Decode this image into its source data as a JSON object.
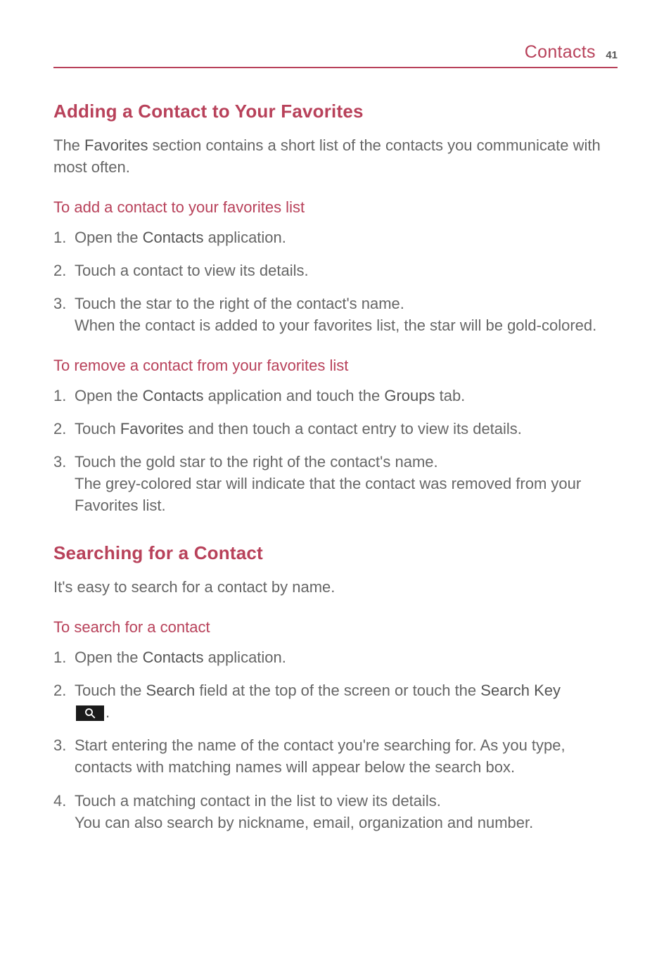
{
  "header": {
    "title": "Contacts",
    "page_number": "41"
  },
  "section1": {
    "heading": "Adding a Contact to Your Favorites",
    "intro_pre": "The ",
    "intro_bold": "Favorites",
    "intro_post": " section contains a short list of the contacts you communicate with most often.",
    "sub1": {
      "heading": "To add a contact to your favorites list",
      "step1_pre": "Open the ",
      "step1_bold": "Contacts",
      "step1_post": " application.",
      "step2": "Touch a contact to view its details.",
      "step3_line1": "Touch the star to the right of the contact's name.",
      "step3_line2": "When the contact is added to your favorites list, the star will be gold-colored."
    },
    "sub2": {
      "heading": "To remove a contact from your favorites list",
      "step1_pre": "Open the ",
      "step1_bold1": "Contacts",
      "step1_mid": " application and touch the ",
      "step1_bold2": "Groups",
      "step1_post": " tab.",
      "step2_pre": "Touch ",
      "step2_bold": "Favorites",
      "step2_post": " and then touch a contact entry to view its details.",
      "step3_line1": "Touch the gold star to the right of the contact's name.",
      "step3_line2": "The grey-colored star will indicate that the contact was removed from your Favorites list."
    }
  },
  "section2": {
    "heading": "Searching for a Contact",
    "intro": "It's easy to search for a contact by name.",
    "sub1": {
      "heading": "To search for a contact",
      "step1_pre": "Open the ",
      "step1_bold": "Contacts",
      "step1_post": " application.",
      "step2_pre": "Touch the ",
      "step2_bold1": "Search",
      "step2_mid": " field at the top of the screen or touch the ",
      "step2_bold2": "Search Key",
      "step2_post": ".",
      "step3": "Start entering the name of the contact you're searching for. As you type, contacts with matching names will appear below the search box.",
      "step4_line1": "Touch a matching contact in the list to view its details.",
      "step4_line2": "You can also search by nickname, email, organization and number."
    }
  }
}
